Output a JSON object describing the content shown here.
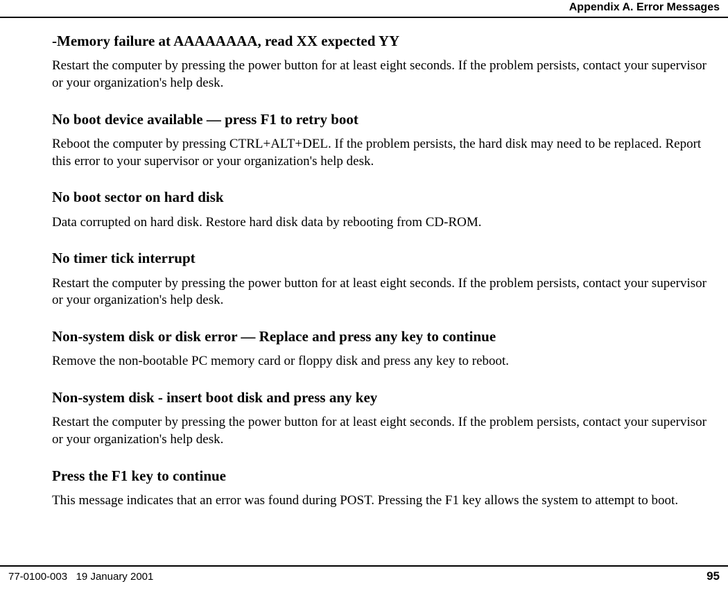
{
  "header": {
    "title": "Appendix A. Error Messages"
  },
  "sections": [
    {
      "heading": "-Memory failure at AAAAAAAA, read XX expected YY",
      "body": "Restart the computer by pressing the power button for at least eight seconds. If the problem persists, contact your supervisor or your organization's help desk."
    },
    {
      "heading": "No boot device available — press F1 to retry boot",
      "body": "Reboot the computer by pressing CTRL+ALT+DEL. If the problem persists, the hard disk may need to be replaced. Report this error to your supervisor or your organization's help desk."
    },
    {
      "heading": "No boot sector on hard disk",
      "body": "Data corrupted on hard disk. Restore hard disk data by rebooting from CD-ROM."
    },
    {
      "heading": "No timer tick interrupt",
      "body": "Restart the computer by pressing the power button for at least eight seconds. If the problem persists, contact your supervisor or your organization's help desk."
    },
    {
      "heading": "Non-system disk or disk error — Replace and press any key to continue",
      "body": "Remove the non-bootable PC memory card or floppy disk and press any key to reboot."
    },
    {
      "heading": "Non-system disk - insert boot disk and press any key",
      "body": "Restart the computer by pressing the power button for at least eight seconds. If the problem persists, contact your supervisor or your organization's help desk."
    },
    {
      "heading": "Press the F1 key to continue",
      "body": "This message indicates that an error was found during POST. Pressing the F1 key allows the system to attempt to boot."
    }
  ],
  "footer": {
    "doc_id": "77-0100-003",
    "date": "19 January 2001",
    "page": "95"
  }
}
